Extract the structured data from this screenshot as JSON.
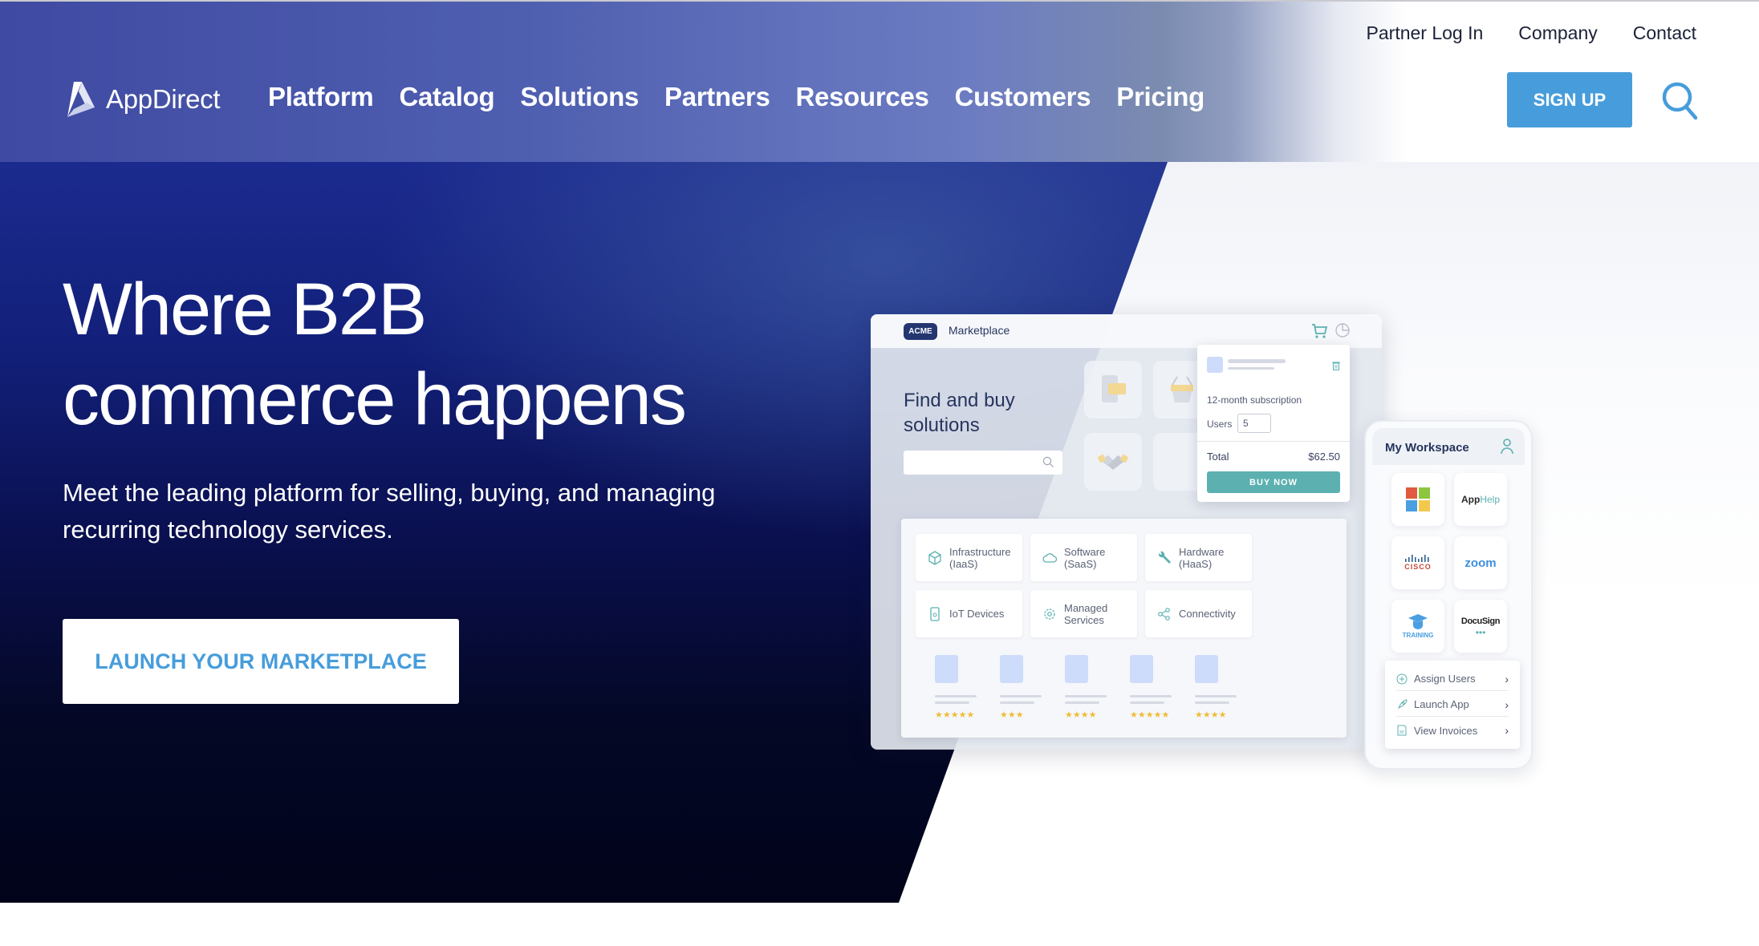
{
  "brand": {
    "name": "AppDirect"
  },
  "nav": {
    "items": [
      "Platform",
      "Catalog",
      "Solutions",
      "Partners",
      "Resources",
      "Customers",
      "Pricing"
    ]
  },
  "utility_nav": {
    "items": [
      "Partner Log In",
      "Company",
      "Contact"
    ]
  },
  "header_actions": {
    "signup_label": "SIGN UP",
    "search_icon": "search-icon"
  },
  "hero": {
    "title_line1": "Where B2B",
    "title_line2": "commerce happens",
    "subtitle_line1": "Meet the leading platform for selling, buying, and managing",
    "subtitle_line2": "recurring technology services.",
    "cta_label": "LAUNCH YOUR MARKETPLACE"
  },
  "marketplace_mockup": {
    "badge": "ACME",
    "title": "Marketplace",
    "find_title_line1": "Find and buy",
    "find_title_line2": "solutions",
    "search_placeholder": "",
    "cart_popup": {
      "subscription": "12-month subscription",
      "users_label": "Users",
      "users_value": "5",
      "total_label": "Total",
      "total_value": "$62.50",
      "buy_label": "BUY NOW"
    },
    "categories": [
      {
        "label_line1": "Infrastructure",
        "label_line2": "(IaaS)",
        "icon": "cube-icon"
      },
      {
        "label_line1": "Software",
        "label_line2": "(SaaS)",
        "icon": "cloud-icon"
      },
      {
        "label_line1": "Hardware",
        "label_line2": "(HaaS)",
        "icon": "wrench-icon"
      },
      {
        "label_line1": "IoT Devices",
        "label_line2": "",
        "icon": "device-icon"
      },
      {
        "label_line1": "Managed",
        "label_line2": "Services",
        "icon": "gear-icon"
      },
      {
        "label_line1": "Connectivity",
        "label_line2": "",
        "icon": "share-icon"
      }
    ],
    "products": [
      {
        "rating": 5,
        "stars": "★★★★★"
      },
      {
        "rating": 3,
        "stars": "★★★"
      },
      {
        "rating": 4,
        "stars": "★★★★"
      },
      {
        "rating": 5,
        "stars": "★★★★★"
      },
      {
        "rating": 4,
        "stars": "★★★★"
      }
    ]
  },
  "workspace_mockup": {
    "title": "My Workspace",
    "apps": [
      "Microsoft",
      "AppHelp",
      "Cisco",
      "zoom",
      "Training",
      "DocuSign"
    ],
    "app_labels": {
      "apphelp_a": "App",
      "apphelp_b": "Help",
      "cisco": "CISCO",
      "zoom": "zoom",
      "training": "TRAINING",
      "docusign": "DocuSign"
    },
    "menu": [
      "Assign Users",
      "Launch App",
      "View Invoices"
    ]
  },
  "colors": {
    "accent_blue": "#479ddb",
    "hero_dark": "#0a1050",
    "teal": "#5cb0b0",
    "star": "#f0bd38"
  }
}
